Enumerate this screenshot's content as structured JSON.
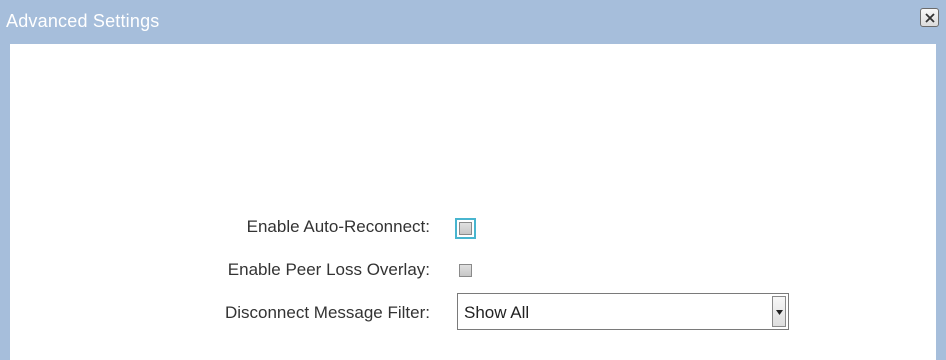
{
  "window": {
    "title": "Advanced Settings",
    "close_icon": "close-icon"
  },
  "settings": {
    "auto_reconnect": {
      "label": "Enable Auto-Reconnect:",
      "checked": false,
      "focused": true
    },
    "peer_loss_overlay": {
      "label": "Enable Peer Loss Overlay:",
      "checked": false
    },
    "disconnect_filter": {
      "label": "Disconnect Message Filter:",
      "value": "Show All",
      "icon": "chevron-down-icon"
    }
  }
}
